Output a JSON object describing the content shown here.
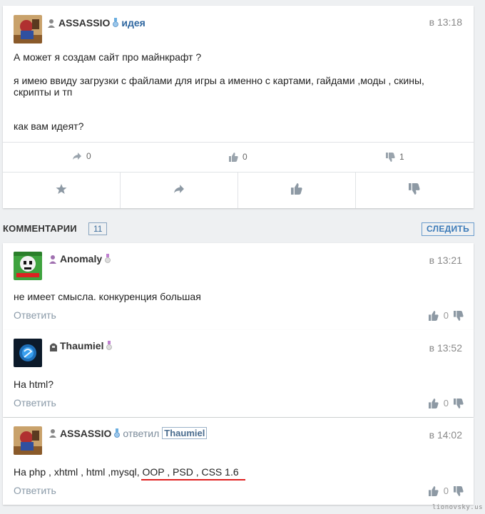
{
  "post": {
    "author": "ASSASSIO",
    "tag": "идея",
    "time": "в 13:18",
    "lines": [
      "А может я создам сайт про майнкрафт ?",
      "я имею ввиду загрузки с файлами для игры а именно с картами, гайдами ,моды , скины,",
      "скрипты и тп",
      "как вам идеят?"
    ],
    "stats": {
      "reposts": "0",
      "likes": "0",
      "dislikes": "1"
    }
  },
  "comments_header": {
    "title": "КОММЕНТАРИИ",
    "count": "11",
    "follow_label": "СЛЕДИТЬ"
  },
  "comments": [
    {
      "author": "Anomaly",
      "time": "в 13:21",
      "text": "не имеет смысла. конкуренция большая",
      "reply": "Ответить",
      "score": "0"
    },
    {
      "author": "Thaumiel",
      "time": "в 13:52",
      "text": "На html?",
      "reply": "Ответить",
      "score": "0"
    },
    {
      "author": "ASSASSIO",
      "replied": "ответил",
      "replied_to": "Thaumiel",
      "time": "в 14:02",
      "text_a": "На php , xhtml , html ,mysql, ",
      "text_b": "OOP , PSD , CSS 1.6",
      "reply": "Ответить",
      "score": "0"
    }
  ],
  "watermark": "lionovsky.us",
  "colors": {
    "accent": "#3b7ab8",
    "underline": "#e02020",
    "background": "#eef0f2"
  }
}
